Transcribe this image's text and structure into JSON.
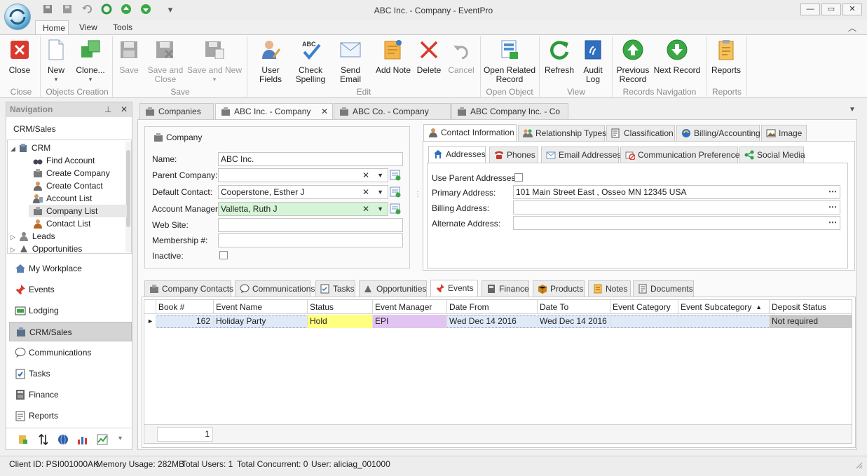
{
  "window": {
    "title": "ABC Inc. - Company - EventPro"
  },
  "ribbon_tabs": [
    "Home",
    "View",
    "Tools"
  ],
  "ribbon": {
    "close": "Close",
    "new": "New",
    "clone": "Clone...",
    "save": "Save",
    "save_close": "Save and Close",
    "save_new": "Save and New",
    "user_fields": "User Fields",
    "check_spelling": "Check Spelling",
    "send_email": "Send Email",
    "add_note": "Add Note",
    "delete": "Delete",
    "cancel": "Cancel",
    "open_related": "Open Related Record",
    "refresh": "Refresh",
    "audit_log": "Audit Log",
    "previous_record": "Previous Record",
    "next_record": "Next Record",
    "reports": "Reports",
    "abc_badge": "ABC",
    "groups": {
      "close": "Close",
      "objects_creation": "Objects Creation",
      "save": "Save",
      "edit": "Edit",
      "open_object": "Open Object",
      "view": "View",
      "records_navigation": "Records Navigation",
      "reports": "Reports"
    }
  },
  "navigation": {
    "header": "Navigation",
    "section": "CRM/Sales",
    "tree": {
      "root": "CRM",
      "items": [
        "Find Account",
        "Create Company",
        "Create Contact",
        "Account List",
        "Company List",
        "Contact List"
      ],
      "leads": "Leads",
      "opportunities": "Opportunities"
    },
    "buttons": [
      "My Workplace",
      "Events",
      "Lodging",
      "CRM/Sales",
      "Communications",
      "Tasks",
      "Finance",
      "Reports"
    ]
  },
  "doc_tabs": [
    "Companies",
    "ABC Inc. - Company",
    "ABC Co. - Company",
    "ABC Company Inc. - Co"
  ],
  "company": {
    "header": "Company",
    "name_label": "Name:",
    "name": "ABC Inc.",
    "parent_label": "Parent Company:",
    "parent": "",
    "default_contact_label": "Default Contact:",
    "default_contact": "Cooperstone, Esther J",
    "account_manager_label": "Account Manager:",
    "account_manager": "Valletta, Ruth J",
    "website_label": "Web Site:",
    "website": "",
    "membership_label": "Membership #:",
    "membership": "",
    "inactive_label": "Inactive:"
  },
  "info_tabs": [
    "Contact Information",
    "Relationship Types",
    "Classification",
    "Billing/Accounting",
    "Image"
  ],
  "contact_tabs": [
    "Addresses",
    "Phones",
    "Email Addresses",
    "Communication Preferences",
    "Social Media"
  ],
  "addresses": {
    "use_parent_label": "Use Parent Addresses:",
    "primary_label": "Primary Address:",
    "primary": "101 Main Street East , Osseo MN 12345 USA",
    "billing_label": "Billing Address:",
    "billing": "",
    "alternate_label": "Alternate Address:",
    "alternate": "",
    "ellipsis": "⋯"
  },
  "lower_tabs": [
    "Company Contacts",
    "Communications",
    "Tasks",
    "Opportunities",
    "Events",
    "Finance",
    "Products",
    "Notes",
    "Documents"
  ],
  "events_grid": {
    "columns": [
      "Book #",
      "Event Name",
      "Status",
      "Event Manager",
      "Date From",
      "Date To",
      "Event Category",
      "Event Subcategory",
      "Deposit Status"
    ],
    "rows": [
      {
        "book": "162",
        "name": "Holiday Party",
        "status": "Hold",
        "manager": "EPI",
        "from": "Wed Dec 14 2016",
        "to": "Wed Dec 14 2016",
        "category": "",
        "subcategory": "",
        "deposit": "Not required"
      }
    ],
    "footer_count": "1",
    "status_color": "#ffff80",
    "manager_color": "#e2c4f2"
  },
  "status_bar": {
    "client": "Client ID: PSI001000AK",
    "memory": "Memory Usage: 282MB",
    "users": "Total Users: 1",
    "concurrent": "Total Concurrent: 0",
    "user": "User: aliciag_001000"
  }
}
